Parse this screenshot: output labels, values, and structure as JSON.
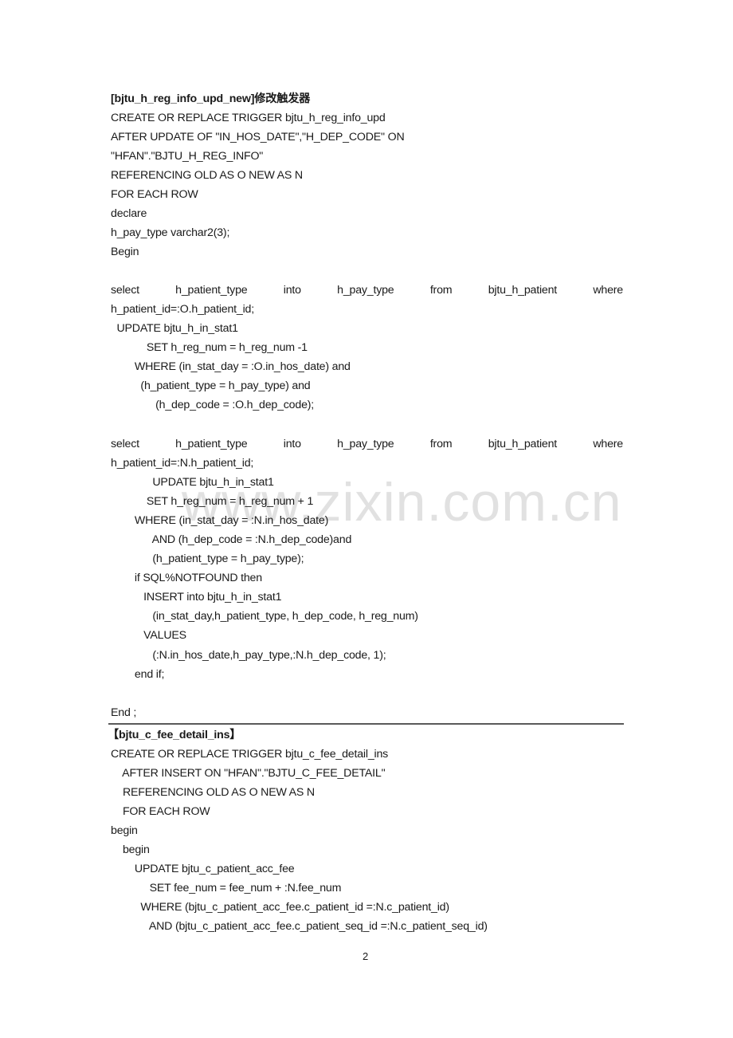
{
  "section1": {
    "heading": "[bjtu_h_reg_info_upd_new]修改触发器",
    "lines": [
      "CREATE OR REPLACE TRIGGER bjtu_h_reg_info_upd",
      "AFTER UPDATE OF \"IN_HOS_DATE\",\"H_DEP_CODE\" ON",
      "\"HFAN\".\"BJTU_H_REG_INFO\"",
      "REFERENCING OLD AS O NEW AS N",
      "FOR EACH ROW",
      "declare",
      "h_pay_type varchar2(3);",
      "Begin"
    ],
    "select1_words": [
      "select",
      "h_patient_type",
      "into",
      "h_pay_type",
      "from",
      "bjtu_h_patient",
      "where"
    ],
    "block1": [
      "h_patient_id=:O.h_patient_id;",
      "  UPDATE bjtu_h_in_stat1",
      "            SET h_reg_num = h_reg_num -1",
      "        WHERE (in_stat_day = :O.in_hos_date) and",
      "          (h_patient_type = h_pay_type) and",
      "               (h_dep_code = :O.h_dep_code);"
    ],
    "select2_words": [
      "select",
      "h_patient_type",
      "into",
      "h_pay_type",
      "from",
      "bjtu_h_patient",
      "where"
    ],
    "block2": [
      "h_patient_id=:N.h_patient_id;",
      "              UPDATE bjtu_h_in_stat1",
      "            SET h_reg_num = h_reg_num + 1",
      "        WHERE (in_stat_day = :N.in_hos_date)",
      "              AND (h_dep_code = :N.h_dep_code)and",
      "              (h_patient_type = h_pay_type);",
      "        if SQL%NOTFOUND then",
      "           INSERT into bjtu_h_in_stat1",
      "              (in_stat_day,h_patient_type, h_dep_code, h_reg_num)",
      "           VALUES",
      "              (:N.in_hos_date,h_pay_type,:N.h_dep_code, 1);",
      "        end if;"
    ],
    "end": "End ;"
  },
  "section2": {
    "heading": "【bjtu_c_fee_detail_ins】",
    "lines": [
      "CREATE OR REPLACE TRIGGER bjtu_c_fee_detail_ins",
      "    AFTER INSERT ON \"HFAN\".\"BJTU_C_FEE_DETAIL\"",
      "    REFERENCING OLD AS O NEW AS N",
      "    FOR EACH ROW",
      "begin",
      "    begin",
      "        UPDATE bjtu_c_patient_acc_fee",
      "             SET fee_num = fee_num + :N.fee_num",
      "          WHERE (bjtu_c_patient_acc_fee.c_patient_id =:N.c_patient_id)",
      "             AND (bjtu_c_patient_acc_fee.c_patient_seq_id =:N.c_patient_seq_id)"
    ]
  },
  "watermark": "www.zixin.com.cn",
  "page_number": "2"
}
